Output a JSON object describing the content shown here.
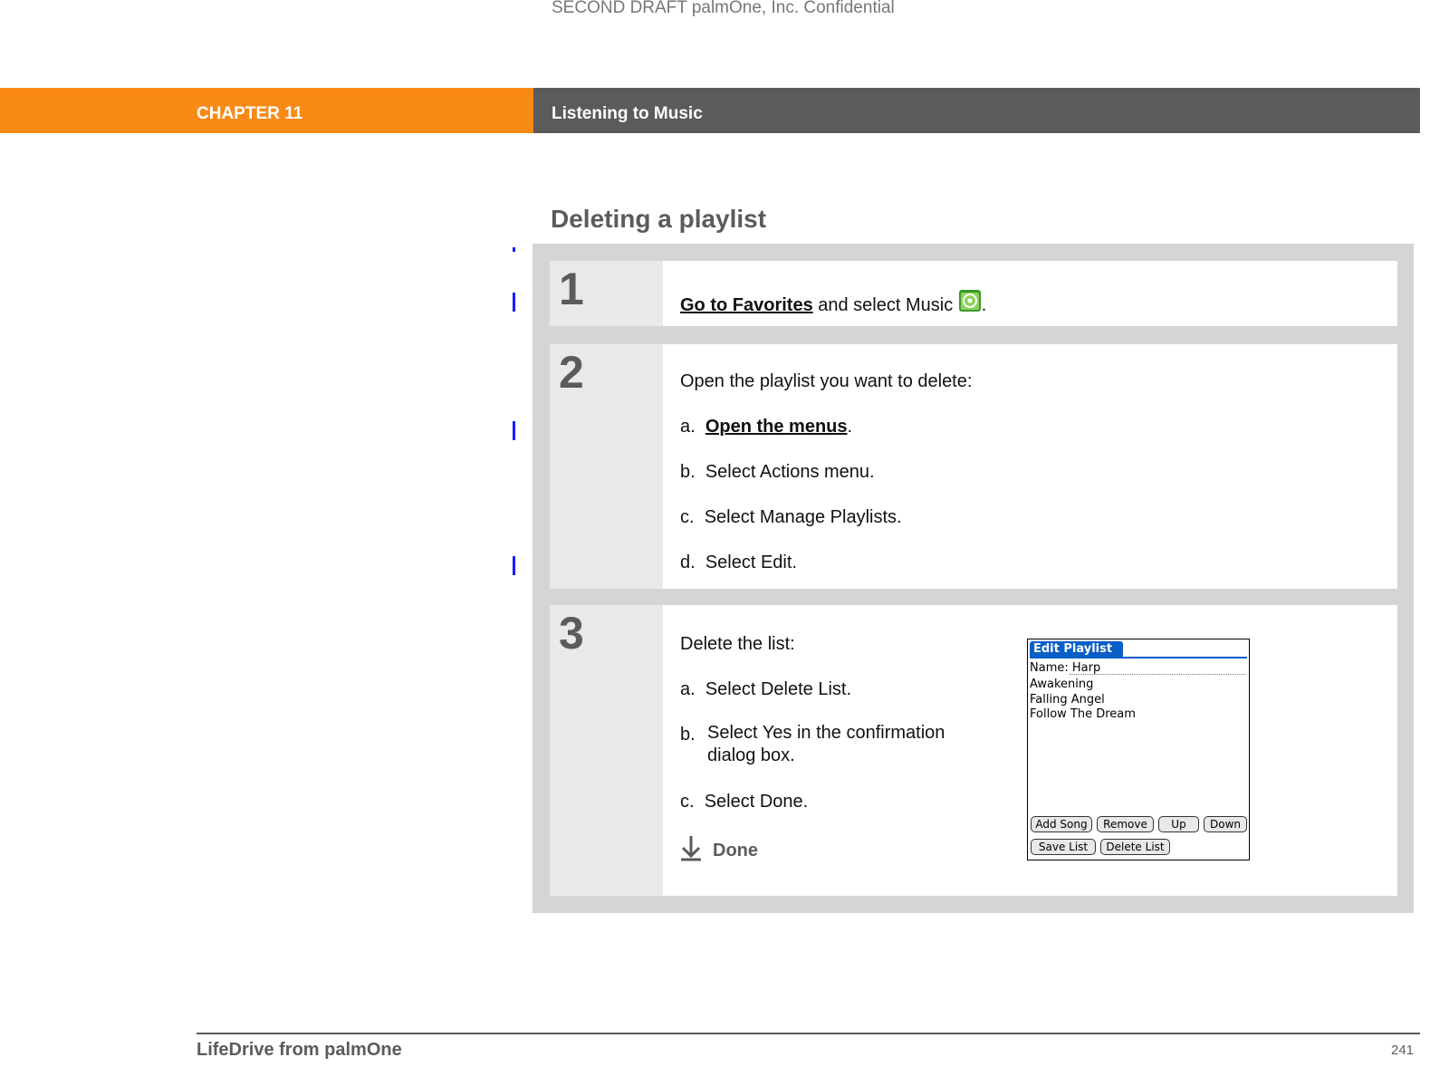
{
  "watermark": "SECOND DRAFT palmOne, Inc.  Confidential",
  "header": {
    "chapter": "CHAPTER 11",
    "title": "Listening to Music"
  },
  "section_title": "Deleting a playlist",
  "steps": [
    {
      "number": "1",
      "link": "Go to Favorites",
      "text": " and select Music ",
      "icon": "music-app-icon",
      "end": "."
    },
    {
      "number": "2",
      "intro": "Open the playlist you want to delete:",
      "items": [
        {
          "letter": "a.",
          "link": "Open the menus",
          "end": "."
        },
        {
          "letter": "b.",
          "text": "Select Actions menu."
        },
        {
          "letter": "c.",
          "text": "Select Manage Playlists."
        },
        {
          "letter": "d.",
          "text": "Select Edit."
        }
      ]
    },
    {
      "number": "3",
      "intro": "Delete the list:",
      "items": [
        {
          "letter": "a.",
          "text": "Select Delete List."
        },
        {
          "letter": "b.",
          "text": "Select Yes in the confirmation dialog box."
        },
        {
          "letter": "c.",
          "text": "Select Done."
        }
      ],
      "done": "Done"
    }
  ],
  "device": {
    "title": "Edit Playlist",
    "name_label": "Name:",
    "name_value": "Harp",
    "songs": [
      "Awakening",
      "Falling Angel",
      "Follow The Dream"
    ],
    "buttons": [
      "Add Song",
      "Remove",
      "Up",
      "Down",
      "Save List",
      "Delete List"
    ]
  },
  "footer": {
    "book": "LifeDrive from palmOne",
    "page": "241"
  },
  "colors": {
    "chapter": "#f98a14",
    "header": "#5b5b5b",
    "panel": "#d5d5d5",
    "change_bar": "#1a1aff"
  }
}
